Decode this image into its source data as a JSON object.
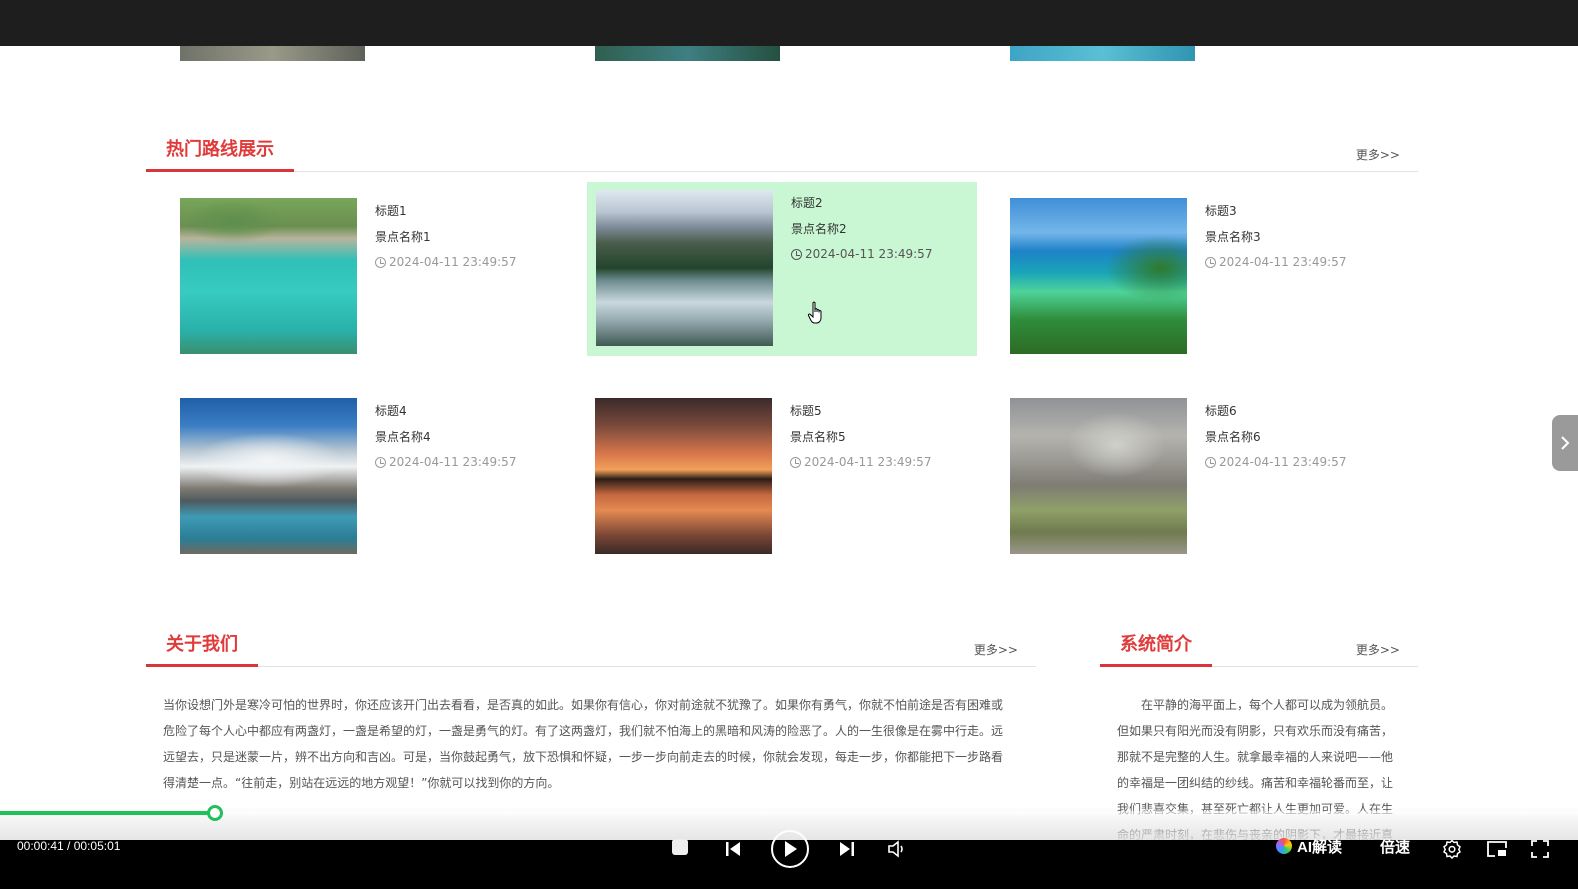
{
  "routes": {
    "title": "热门路线展示",
    "more": "更多>>",
    "items": [
      {
        "title": "标题1",
        "name": "景点名称1",
        "date": "2024-04-11 23:49:57"
      },
      {
        "title": "标题2",
        "name": "景点名称2",
        "date": "2024-04-11 23:49:57"
      },
      {
        "title": "标题3",
        "name": "景点名称3",
        "date": "2024-04-11 23:49:57"
      },
      {
        "title": "标题4",
        "name": "景点名称4",
        "date": "2024-04-11 23:49:57"
      },
      {
        "title": "标题5",
        "name": "景点名称5",
        "date": "2024-04-11 23:49:57"
      },
      {
        "title": "标题6",
        "name": "景点名称6",
        "date": "2024-04-11 23:49:57"
      }
    ],
    "highlight_color": "#c9f7d3"
  },
  "about": {
    "title": "关于我们",
    "more": "更多>>",
    "text": "当你设想门外是寒冷可怕的世界时，你还应该开门出去看看，是否真的如此。如果你有信心，你对前途就不犹豫了。如果你有勇气，你就不怕前途是否有困难或危险了每个人心中都应有两盏灯，一盏是希望的灯，一盏是勇气的灯。有了这两盏灯，我们就不怕海上的黑暗和风涛的险恶了。人的一生很像是在雾中行走。远远望去，只是迷蒙一片，辨不出方向和吉凶。可是，当你鼓起勇气，放下恐惧和怀疑，一步一步向前走去的时候，你就会发现，每走一步，你都能把下一步路看得清楚一点。“往前走，别站在远远的地方观望！”你就可以找到你的方向。"
  },
  "system": {
    "title": "系统简介",
    "more": "更多>>",
    "text": "在平静的海平面上，每个人都可以成为领航员。但如果只有阳光而没有阴影，只有欢乐而没有痛苦，那就不是完整的人生。就拿最幸福的人来说吧——他的幸福是一团纠结的纱线。痛苦和幸福轮番而至，让我们悲喜交集，甚至死亡都让人生更加可爱。人在生命的严肃时刻，在悲伤与丧亲的阴影下，才最接近真"
  },
  "player": {
    "time": "00:00:41 / 00:05:01",
    "progress_fraction": 0.136,
    "ai_label": "AI解读",
    "speed_label": "倍速",
    "accent": "#20c05c"
  },
  "brand_color": "#e03b3b"
}
